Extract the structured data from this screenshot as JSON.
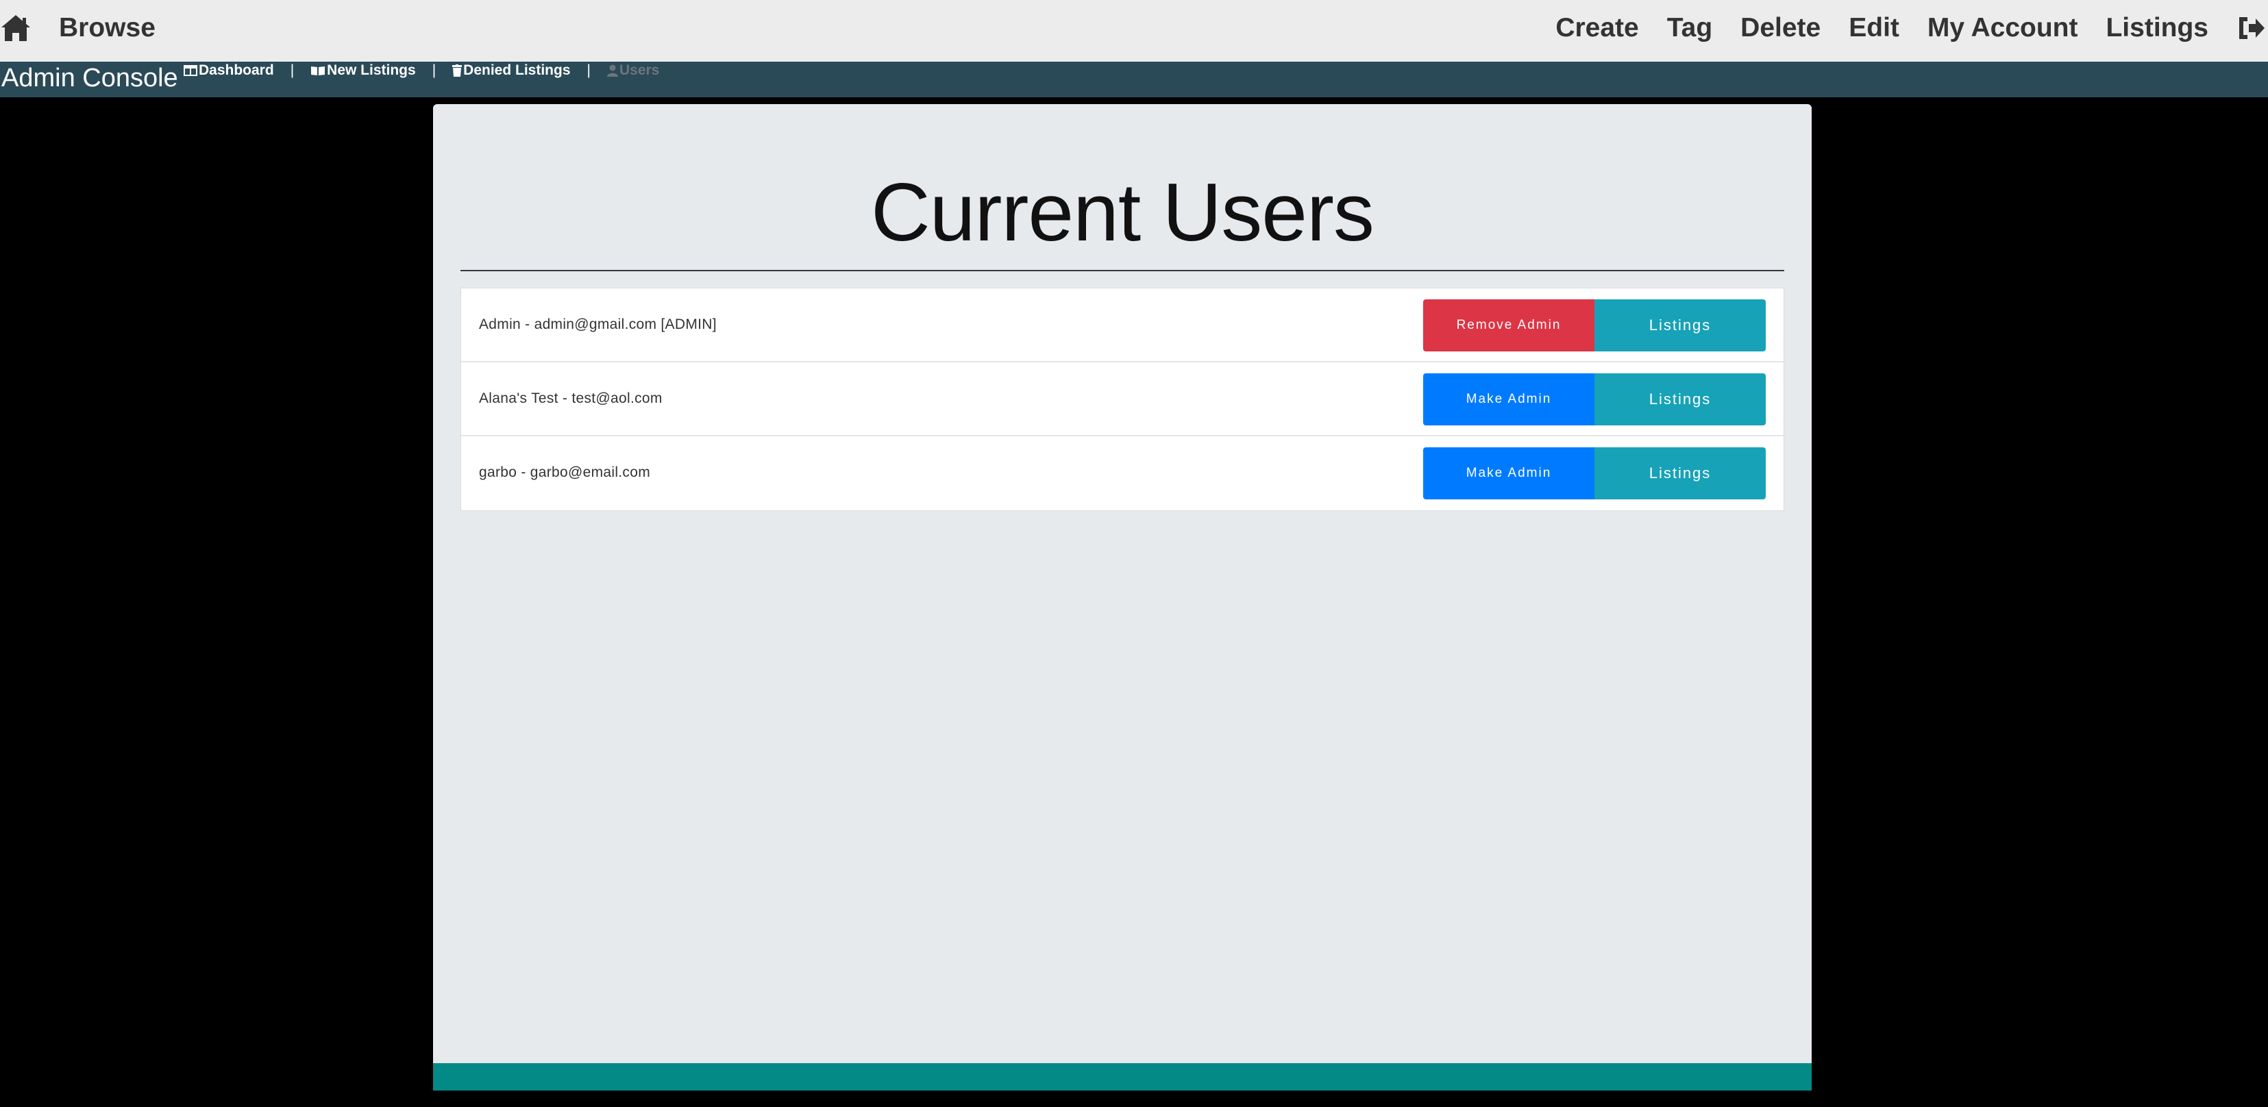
{
  "topnav": {
    "home_icon": "home-icon",
    "browse": "Browse",
    "links": [
      "Create",
      "Tag",
      "Delete",
      "Edit",
      "My Account",
      "Listings"
    ],
    "signout_icon": "sign-out-icon"
  },
  "adminbar": {
    "title": "Admin Console",
    "links": [
      {
        "label": "Dashboard",
        "icon": "columns-icon"
      },
      {
        "label": "New Listings",
        "icon": "book-open-icon"
      },
      {
        "label": "Denied Listings",
        "icon": "trash-icon"
      },
      {
        "label": "Users",
        "icon": "user-icon"
      }
    ],
    "separator": "|"
  },
  "main": {
    "heading": "Current Users",
    "users": [
      {
        "label": "Admin - admin@gmail.com [ADMIN]",
        "admin_action": "Remove Admin",
        "listings": "Listings"
      },
      {
        "label": "Alana's Test - test@aol.com",
        "admin_action": "Make Admin",
        "listings": "Listings"
      },
      {
        "label": "garbo - garbo@email.com",
        "admin_action": "Make Admin",
        "listings": "Listings"
      }
    ]
  },
  "colors": {
    "adminbar": "#2b4a58",
    "danger": "#dc3545",
    "primary": "#007bff",
    "info": "#17a2b8",
    "footer": "#038a87"
  }
}
